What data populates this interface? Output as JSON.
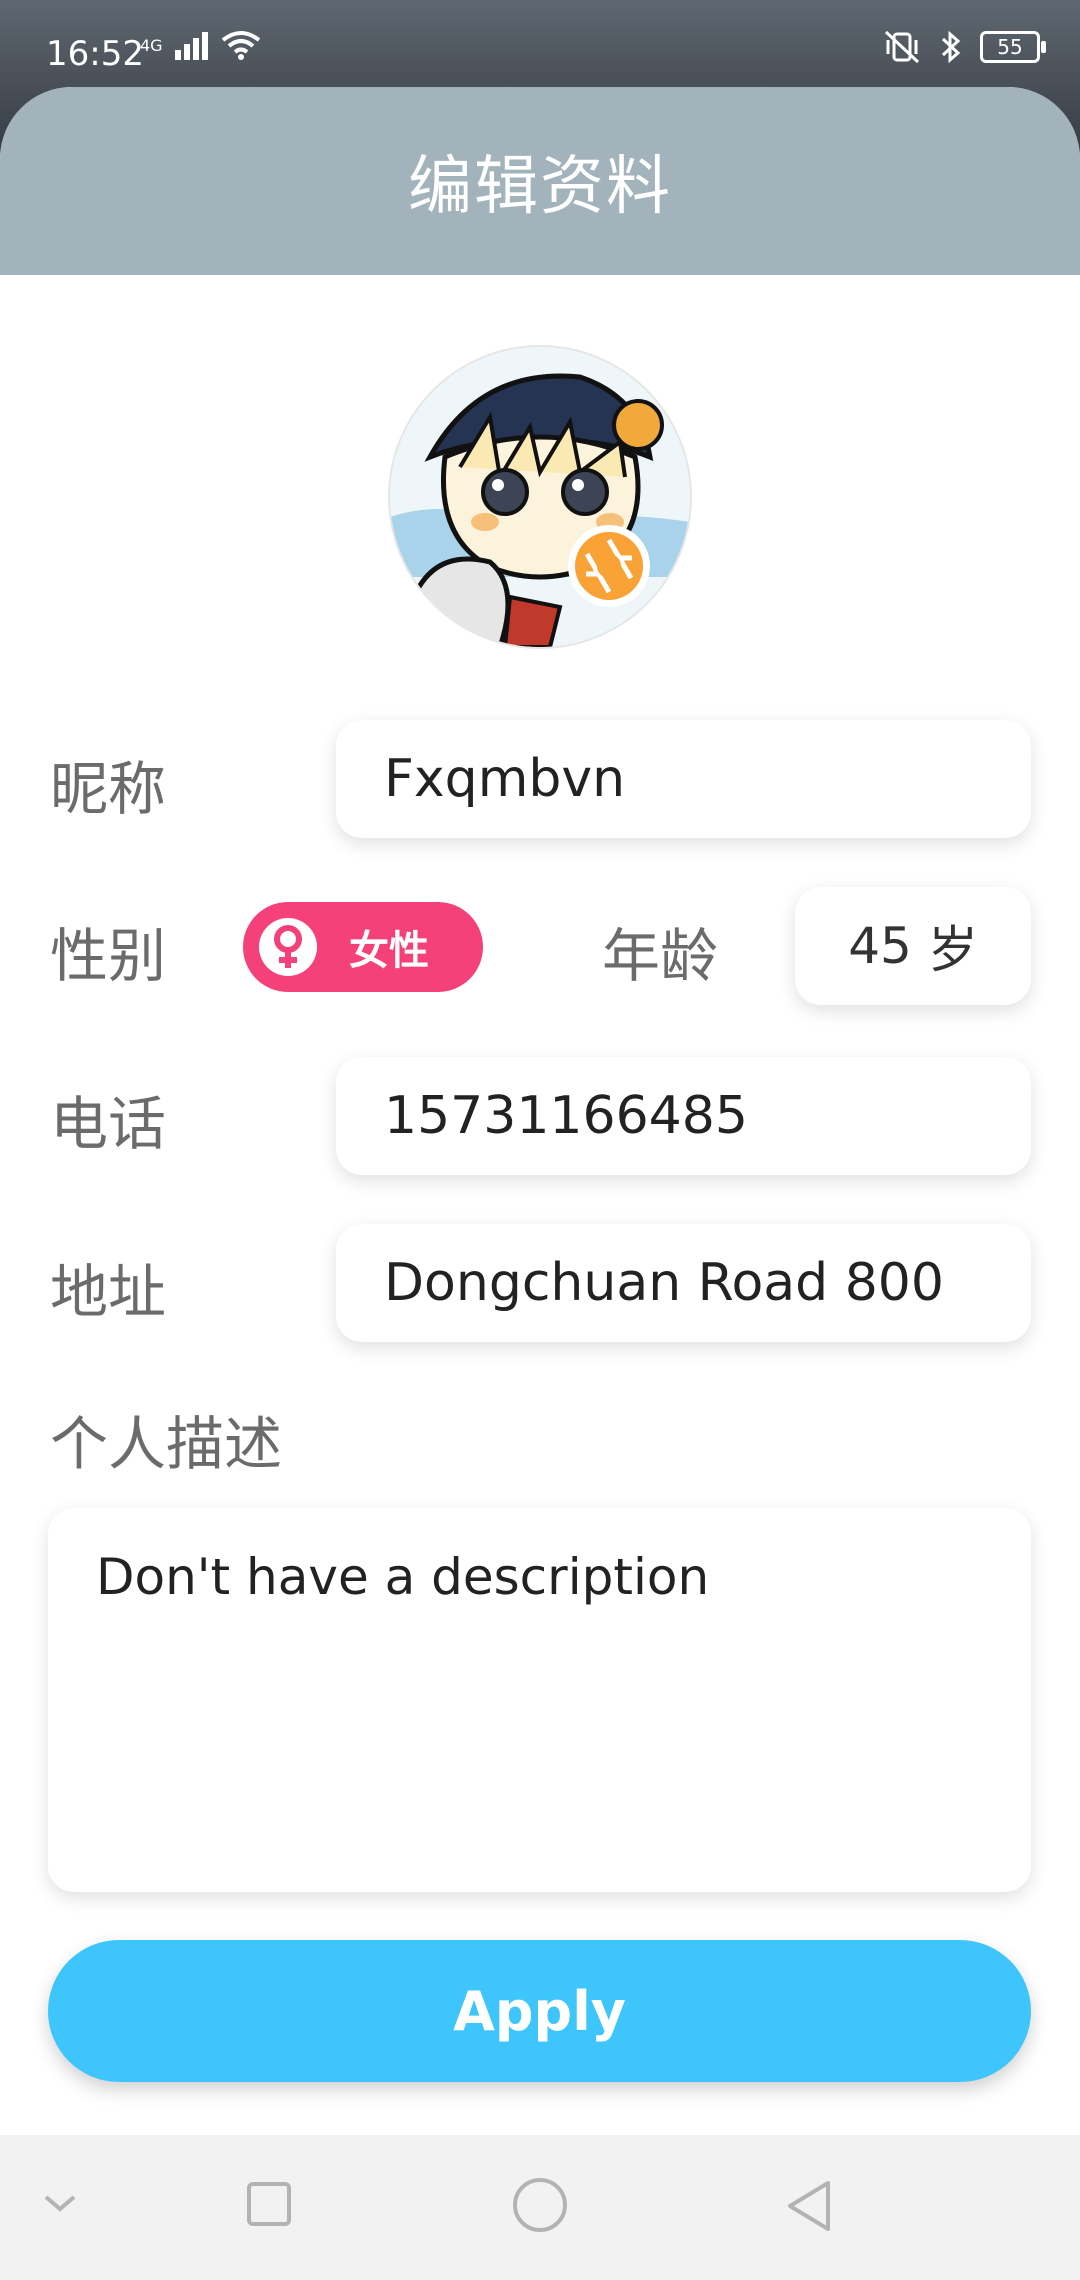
{
  "status_bar": {
    "time": "16:52",
    "network": "4G",
    "battery": "55"
  },
  "header": {
    "title": "编辑资料"
  },
  "profile": {
    "nickname_label": "昵称",
    "nickname": "Fxqmbvn",
    "gender_label": "性别",
    "gender": "女性",
    "age_label": "年龄",
    "age": "45",
    "age_unit": "岁",
    "phone_label": "电话",
    "phone": "15731166485",
    "address_label": "地址",
    "address": "Dongchuan Road 800",
    "description_label": "个人描述",
    "description": "Don't have a description"
  },
  "actions": {
    "apply_label": "Apply"
  },
  "colors": {
    "header_bg": "#a2b3bc",
    "gender_pill": "#f4417a",
    "apply_button": "#3ec5fb",
    "camera_badge": "#f9a336"
  },
  "icons": {
    "camera": "camera-shutter-icon",
    "female": "female-symbol-icon",
    "nav_back": "triangle-back-icon",
    "nav_home": "circle-home-icon",
    "nav_recent": "square-recent-icon",
    "nav_down": "chevron-down-icon"
  }
}
